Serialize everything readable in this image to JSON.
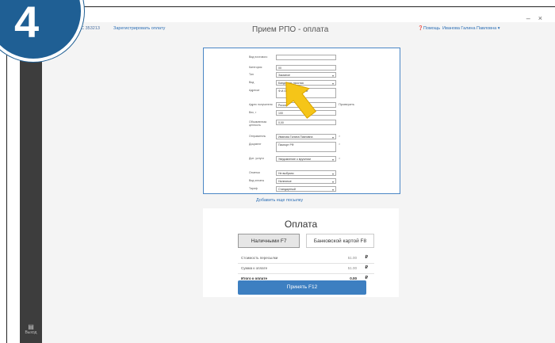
{
  "step": {
    "number": "4"
  },
  "window_controls": {
    "min": "–",
    "close": "×"
  },
  "topbar": {
    "office": "ОПС 353213",
    "office_icon": "office-icon",
    "link": "Зарегистрировать оплату",
    "title": "Прием РПО - оплата",
    "help": "Помощь",
    "user": "Иванова Галина Павловна ▾"
  },
  "sidebar": {
    "exit_label": "Выход"
  },
  "form": {
    "rows": [
      {
        "label": "Вид почтового",
        "value": "",
        "kind": "text"
      },
      {
        "label": "Категория",
        "value": "00",
        "kind": "text"
      },
      {
        "label": "Тип",
        "value": "Заказное",
        "kind": "select"
      },
      {
        "label": "Вид",
        "value": "Бандероль простая",
        "kind": "select"
      },
      {
        "label": "Адресат",
        "value": "Ф.И.О. / наименование",
        "kind": "tall"
      },
      {
        "label": "Адрес получателя",
        "value": "Россия",
        "kind": "text",
        "side": "Проверить"
      },
      {
        "label": "Вес, г",
        "value": "100",
        "kind": "text"
      },
      {
        "label": "Объявленная ценность",
        "value": "0,00",
        "kind": "text"
      },
      {
        "label": "Отправитель",
        "value": "Иванова Галина Павловна",
        "kind": "select",
        "side": "×"
      },
      {
        "label": "Документ",
        "value": "Паспорт РФ",
        "kind": "tall",
        "side": "×"
      },
      {
        "label": "Доп. услуги",
        "value": "Уведомление о вручении",
        "kind": "select",
        "side": "×"
      },
      {
        "label": "Отметки",
        "value": "Не выбрано",
        "kind": "select"
      },
      {
        "label": "Вид оплаты",
        "value": "Наличные",
        "kind": "select"
      },
      {
        "label": "Тариф",
        "value": "Стандартный",
        "kind": "select"
      }
    ],
    "add_link": "Добавить еще посылку"
  },
  "payment": {
    "title": "Оплата",
    "cash_label": "Наличными F7",
    "card_label": "Банковской картой F8",
    "rows": [
      {
        "label": "Стоимость пересылки",
        "value": "51.00",
        "currency": "₽"
      },
      {
        "label": "Сумма к оплате",
        "value": "51.00",
        "currency": "₽"
      },
      {
        "label": "Итого к оплате",
        "value": "0.00",
        "currency": "₽"
      }
    ],
    "accept_label": "Принять F12"
  },
  "colors": {
    "accent": "#3d7fc1",
    "badge": "#1f5f94",
    "pointer": "#f5c518",
    "sidebar": "#3d3d3d"
  }
}
